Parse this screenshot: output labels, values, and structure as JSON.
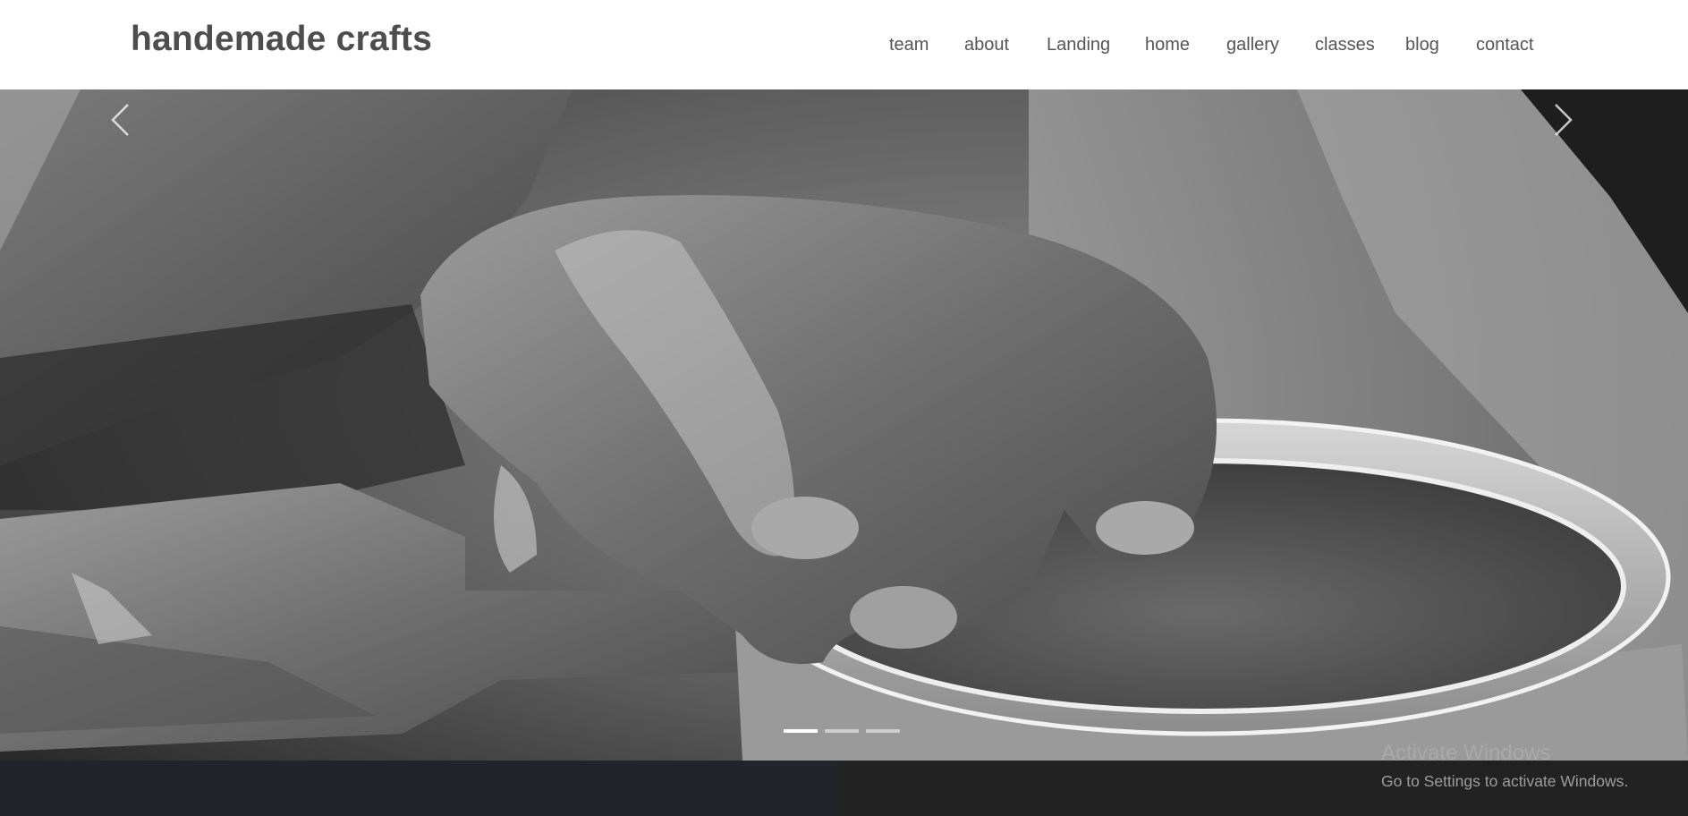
{
  "header": {
    "brand": "handemade crafts",
    "nav": [
      "team",
      "about",
      "Landing",
      "home",
      "gallery",
      "classes",
      "blog",
      "contact"
    ]
  },
  "carousel": {
    "image": "Black-and-white close-up of clay-covered hands shaping a pot on a pottery wheel",
    "prev_icon": "chevron-left-icon",
    "next_icon": "chevron-right-icon",
    "slide_count": 3,
    "active_slide": 1
  },
  "watermark": {
    "title": "Activate Windows",
    "subtitle": "Go to Settings to activate Windows."
  },
  "colors": {
    "brand_text": "#4d4d4d",
    "nav_text": "#555555",
    "footer_left": "#212529",
    "footer_right": "#222222"
  }
}
